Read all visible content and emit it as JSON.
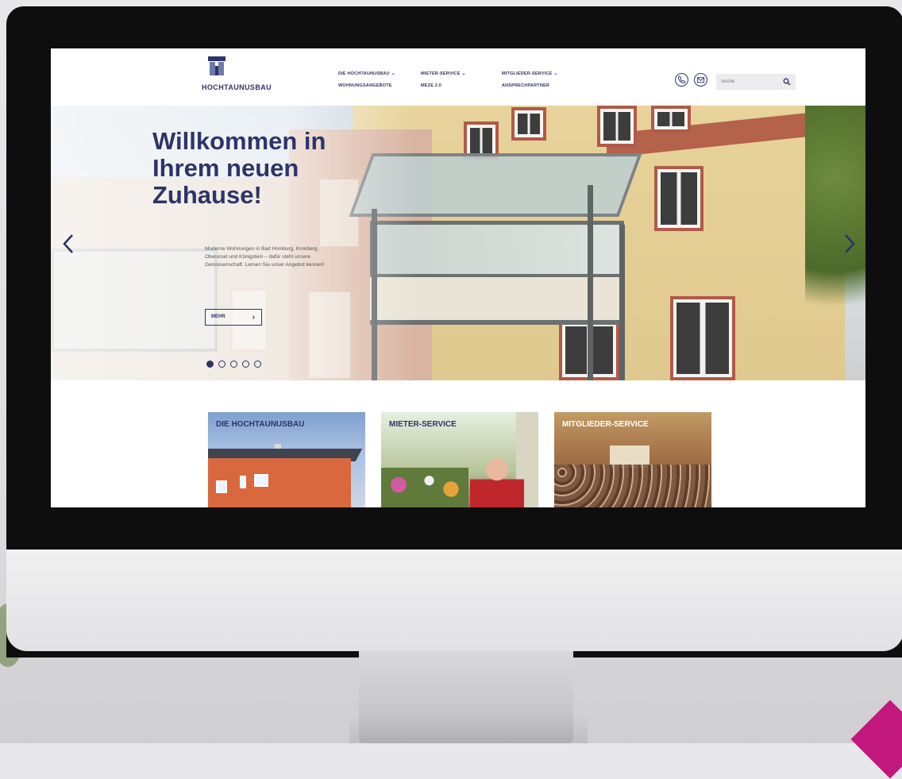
{
  "header": {
    "logo_text": "HOCHTAUNUSBAU",
    "nav": [
      {
        "label": "DIE HOCHTAUNUSBAU",
        "dropdown": true
      },
      {
        "label": "WOHNUNGSANGEBOTE",
        "dropdown": false
      },
      {
        "label": "MIETER-SERVICE",
        "dropdown": true
      },
      {
        "label": "MEZE 2.0",
        "dropdown": false
      },
      {
        "label": "MITGLIEDER-SERVICE",
        "dropdown": true
      },
      {
        "label": "ANSPRECHPARTNER",
        "dropdown": false
      }
    ],
    "icons": [
      "phone-icon",
      "mail-icon",
      "search-icon"
    ],
    "search": {
      "placeholder": "Suche",
      "value": ""
    }
  },
  "hero": {
    "title": "Willkommen in Ihrem neuen Zuhause!",
    "text": "Moderne Wohnungen in Bad Homburg, Kronberg, Oberursel und Königstein – dafür steht unsere Genossenschaft. Lernen Sie unser Angebot kennen!",
    "button_label": "MEHR",
    "slide_count": 5,
    "active_slide": 1
  },
  "tiles": [
    {
      "label": "DIE HOCHTAUNUSBAU"
    },
    {
      "label": "MIETER-SERVICE"
    },
    {
      "label": "MITGLIEDER-SERVICE"
    }
  ],
  "colors": {
    "brand_navy": "#2e3468",
    "accent_magenta": "#c2187e",
    "page_bg": "#ffffff"
  }
}
